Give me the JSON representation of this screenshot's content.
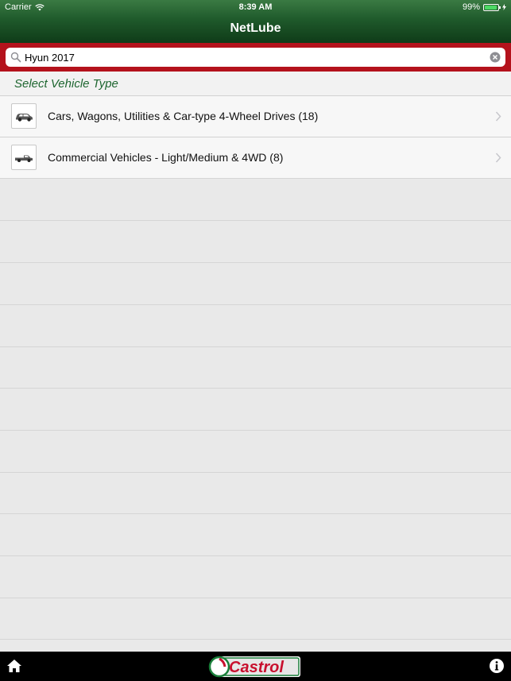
{
  "status": {
    "carrier": "Carrier",
    "time": "8:39 AM",
    "battery": "99%"
  },
  "header": {
    "title": "NetLube"
  },
  "search": {
    "value": "Hyun 2017",
    "placeholder": ""
  },
  "section": {
    "title": "Select Vehicle Type"
  },
  "rows": [
    {
      "label": "Cars, Wagons, Utilities & Car-type 4-Wheel Drives (18)",
      "icon": "car-icon"
    },
    {
      "label": "Commercial Vehicles - Light/Medium & 4WD (8)",
      "icon": "truck-icon"
    }
  ],
  "footer": {
    "logo_text": "Castrol"
  },
  "colors": {
    "header_green": "#1f5a2b",
    "search_red": "#b4121c",
    "section_green": "#1e6630"
  }
}
